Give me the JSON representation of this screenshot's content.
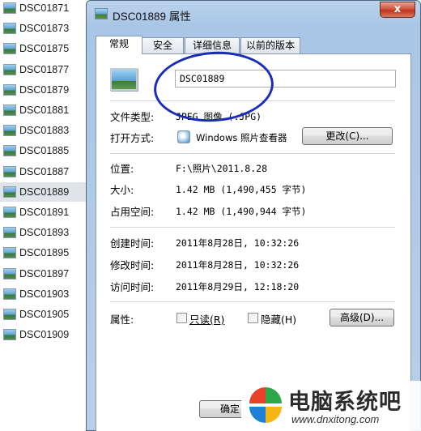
{
  "file_list": [
    {
      "name": "DSC01871",
      "selected": false
    },
    {
      "name": "DSC01873",
      "selected": false
    },
    {
      "name": "DSC01875",
      "selected": false
    },
    {
      "name": "DSC01877",
      "selected": false
    },
    {
      "name": "DSC01879",
      "selected": false
    },
    {
      "name": "DSC01881",
      "selected": false
    },
    {
      "name": "DSC01883",
      "selected": false
    },
    {
      "name": "DSC01885",
      "selected": false
    },
    {
      "name": "DSC01887",
      "selected": false
    },
    {
      "name": "DSC01889",
      "selected": true
    },
    {
      "name": "DSC01891",
      "selected": false
    },
    {
      "name": "DSC01893",
      "selected": false
    },
    {
      "name": "DSC01895",
      "selected": false
    },
    {
      "name": "DSC01897",
      "selected": false
    },
    {
      "name": "DSC01903",
      "selected": false
    },
    {
      "name": "DSC01905",
      "selected": false
    },
    {
      "name": "DSC01909",
      "selected": false
    }
  ],
  "dialog": {
    "title": "DSC01889 属性",
    "close_label": "x",
    "tabs": [
      {
        "label": "常规",
        "active": true
      },
      {
        "label": "安全",
        "active": false
      },
      {
        "label": "详细信息",
        "active": false
      },
      {
        "label": "以前的版本",
        "active": false
      }
    ],
    "file_name_value": "DSC01889",
    "fields": {
      "file_type_label": "文件类型:",
      "file_type_value": "JPEG 图像 (.JPG)",
      "open_with_label": "打开方式:",
      "open_with_value": "Windows 照片查看器",
      "change_button": "更改(C)...",
      "location_label": "位置:",
      "location_value": "F:\\照片\\2011.8.28",
      "size_label": "大小:",
      "size_value": "1.42 MB (1,490,455 字节)",
      "size_on_disk_label": "占用空间:",
      "size_on_disk_value": "1.42 MB (1,490,944 字节)",
      "created_label": "创建时间:",
      "created_value": "2011年8月28日, 10:32:26",
      "modified_label": "修改时间:",
      "modified_value": "2011年8月28日, 10:32:26",
      "accessed_label": "访问时间:",
      "accessed_value": "2011年8月29日, 12:18:20",
      "attributes_label": "属性:",
      "readonly_label": "只读(R)",
      "hidden_label": "隐藏(H)",
      "advanced_button": "高级(D)..."
    },
    "ok_button": "确定"
  },
  "watermark": {
    "title": "电脑系统吧",
    "url": "www.dnxitong.com"
  },
  "colors": {
    "annotation_circle": "#1a2db5",
    "close_button": "#c1341c",
    "dialog_frame": "#a9c6e6"
  }
}
